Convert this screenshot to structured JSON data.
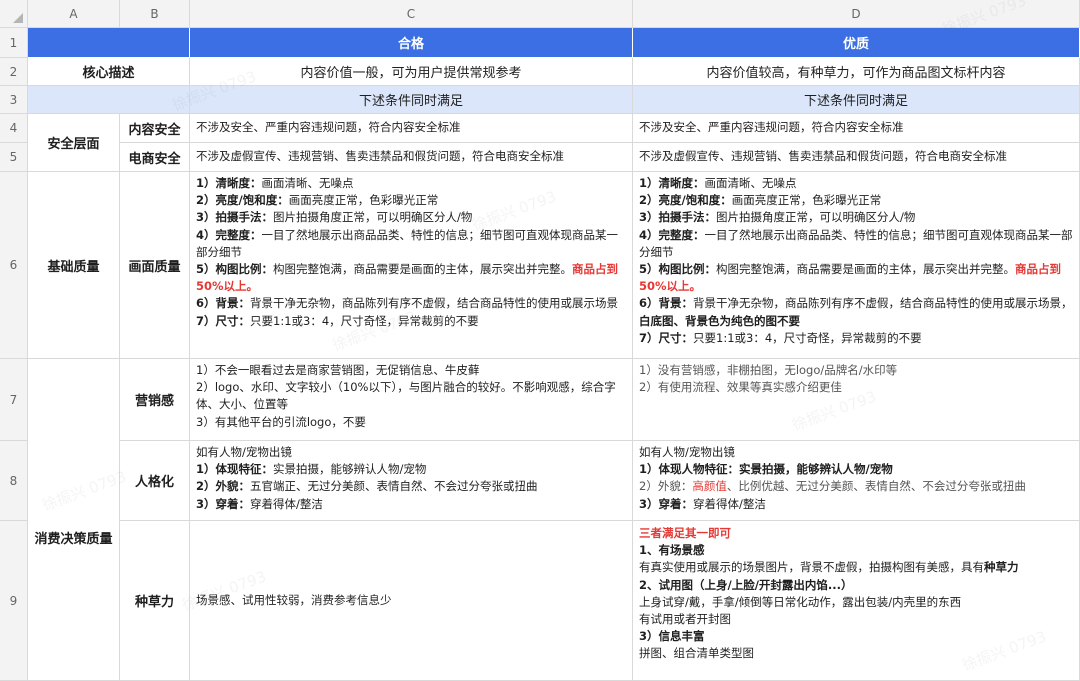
{
  "columns": [
    "A",
    "B",
    "C",
    "D"
  ],
  "rows": [
    "1",
    "2",
    "3",
    "4",
    "5",
    "6",
    "7",
    "8",
    "9"
  ],
  "watermark": "徐振兴 0793",
  "header": {
    "qualified": "合格",
    "excellent": "优质"
  },
  "core": {
    "label": "核心描述",
    "qualified": "内容价值一般，可为用户提供常规参考",
    "excellent": "内容价值较高，有种草力，可作为商品图文标杆内容"
  },
  "condition": {
    "qualified": "下述条件同时满足",
    "excellent": "下述条件同时满足"
  },
  "safety": {
    "group": "安全层面",
    "content_label": "内容安全",
    "content_qualified": "不涉及安全、严重内容违规问题，符合内容安全标准",
    "content_excellent": "不涉及安全、严重内容违规问题，符合内容安全标准",
    "ecom_label": "电商安全",
    "ecom_qualified": "不涉及虚假宣传、违规营销、售卖违禁品和假货问题，符合电商安全标准",
    "ecom_excellent": "不涉及虚假宣传、违规营销、售卖违禁品和假货问题，符合电商安全标准"
  },
  "basic": {
    "group": "基础质量",
    "label": "画面质量",
    "qualified": {
      "i1b": "1）清晰度：",
      "i1": "画面清晰、无噪点",
      "i2b": "2）亮度/饱和度：",
      "i2": "画面亮度正常，色彩曝光正常",
      "i3b": "3）拍摄手法：",
      "i3": "图片拍摄角度正常，可以明确区分人/物",
      "i4b": "4）完整度：",
      "i4": "一目了然地展示出商品品类、特性的信息；细节图可直观体现商品某一部分细节",
      "i5b": "5）构图比例：",
      "i5": "构图完整饱满，商品需要是画面的主体，展示突出并完整。",
      "i5r": "商品占到50%以上。",
      "i6b": "6）背景：",
      "i6": "背景干净无杂物，商品陈列有序不虚假，结合商品特性的使用或展示场景",
      "i7b": "7）尺寸：",
      "i7": "只要1:1或3：4，尺寸奇怪，异常裁剪的不要"
    },
    "excellent": {
      "i1b": "1）清晰度：",
      "i1": "画面清晰、无噪点",
      "i2b": "2）亮度/饱和度：",
      "i2": "画面亮度正常，色彩曝光正常",
      "i3b": "3）拍摄手法：",
      "i3": "图片拍摄角度正常，可以明确区分人/物",
      "i4b": "4）完整度：",
      "i4": "一目了然地展示出商品品类、特性的信息；细节图可直观体现商品某一部分细节",
      "i5b": "5）构图比例：",
      "i5": "构图完整饱满，商品需要是画面的主体，展示突出并完整。",
      "i5r": "商品占到50%以上。",
      "i6b": "6）背景：",
      "i6": "背景干净无杂物，商品陈列有序不虚假，结合商品特性的使用或展示场景，",
      "i6x": "白底图、背景色为纯色的图不要",
      "i7b": "7）尺寸：",
      "i7": "只要1:1或3：4，尺寸奇怪，异常裁剪的不要"
    }
  },
  "marketing": {
    "label": "营销感",
    "qualified": [
      "1）不会一眼看过去是商家营销图，无促销信息、牛皮藓",
      "2）logo、水印、文字较小（10%以下），与图片融合的较好。不影响观感，综合字体、大小、位置等",
      "3）有其他平台的引流logo，不要"
    ],
    "excellent": [
      "1）没有营销感，非棚拍图，无logo/品牌名/水印等",
      "2）有使用流程、效果等真实感介绍更佳"
    ]
  },
  "decision_group": "消费决策质量",
  "persona": {
    "label": "人格化",
    "qualified": {
      "intro": "如有人物/宠物出镜",
      "i1b": "1）体现特征：",
      "i1": "实景拍摄，能够辨认人物/宠物",
      "i2b": "2）外貌：",
      "i2": "五官端正、无过分美颜、表情自然、不会过分夸张或扭曲",
      "i3b": "3）穿着：",
      "i3": "穿着得体/整洁"
    },
    "excellent": {
      "intro": "如有人物/宠物出镜",
      "i1": "1）体现人物特征：实景拍摄，能够辨认人物/宠物",
      "i2a": "2）外貌：",
      "i2r": "高颜值",
      "i2": "、比例优越、无过分美颜、表情自然、不会过分夸张或扭曲",
      "i3b": "3）穿着：",
      "i3": "穿着得体/整洁"
    }
  },
  "seeding": {
    "label": "种草力",
    "qualified": "场景感、试用性较弱，消费参考信息少",
    "excellent": {
      "note": "三者满足其一即可",
      "h1": "1、有场景感",
      "t1": "有真实使用或展示的场景图片，背景不虚假，拍摄构图有美感，具有",
      "t1b": "种草力",
      "h2": "2、试用图（上身/上脸/开封露出内馅...）",
      "t2a": "上身试穿/戴，手拿/倾倒等日常化动作，露出包装/内壳里的东西",
      "t2b": "有试用或者开封图",
      "h3": "3）信息丰富",
      "t3": "拼图、组合清单类型图"
    }
  }
}
